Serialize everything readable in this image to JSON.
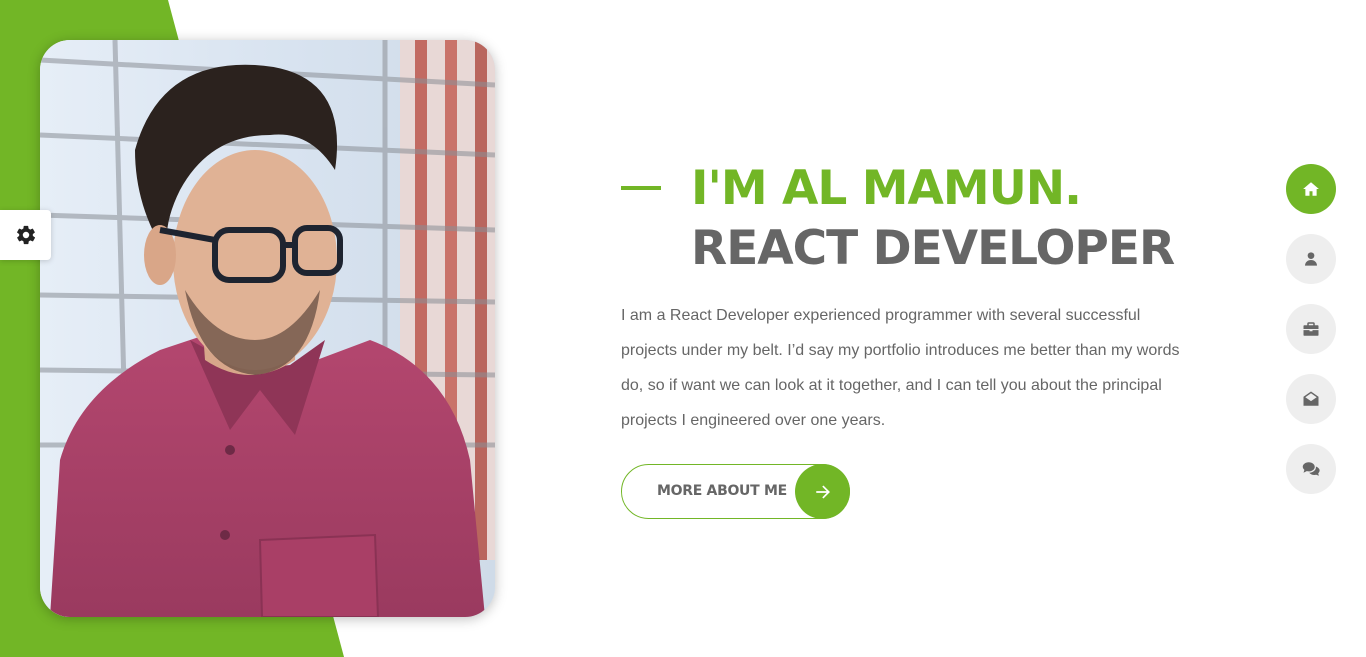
{
  "colors": {
    "accent": "#72b626",
    "heading_gray": "#666666",
    "text_gray": "#666666",
    "nav_inactive_bg": "#eeeeee",
    "nav_inactive_icon": "#666666",
    "nav_active_icon": "#ffffff"
  },
  "settings": {
    "icon": "gear-icon"
  },
  "hero": {
    "name_line": "I'M AL MAMUN.",
    "role_line": "REACT DEVELOPER",
    "bio": "I am a React Developer experienced programmer with several successful projects under my belt. I’d say my portfolio introduces me better than my words do, so if want we can look at it together, and I can tell you about the principal projects I engineered over one years.",
    "cta": {
      "label": "MORE ABOUT ME",
      "icon": "arrow-right-icon"
    }
  },
  "photo": {
    "subject": "profile-photo"
  },
  "side_nav": {
    "items": [
      {
        "icon": "home-icon",
        "active": true
      },
      {
        "icon": "user-icon",
        "active": false
      },
      {
        "icon": "briefcase-icon",
        "active": false
      },
      {
        "icon": "envelope-open-icon",
        "active": false
      },
      {
        "icon": "comments-icon",
        "active": false
      }
    ]
  }
}
